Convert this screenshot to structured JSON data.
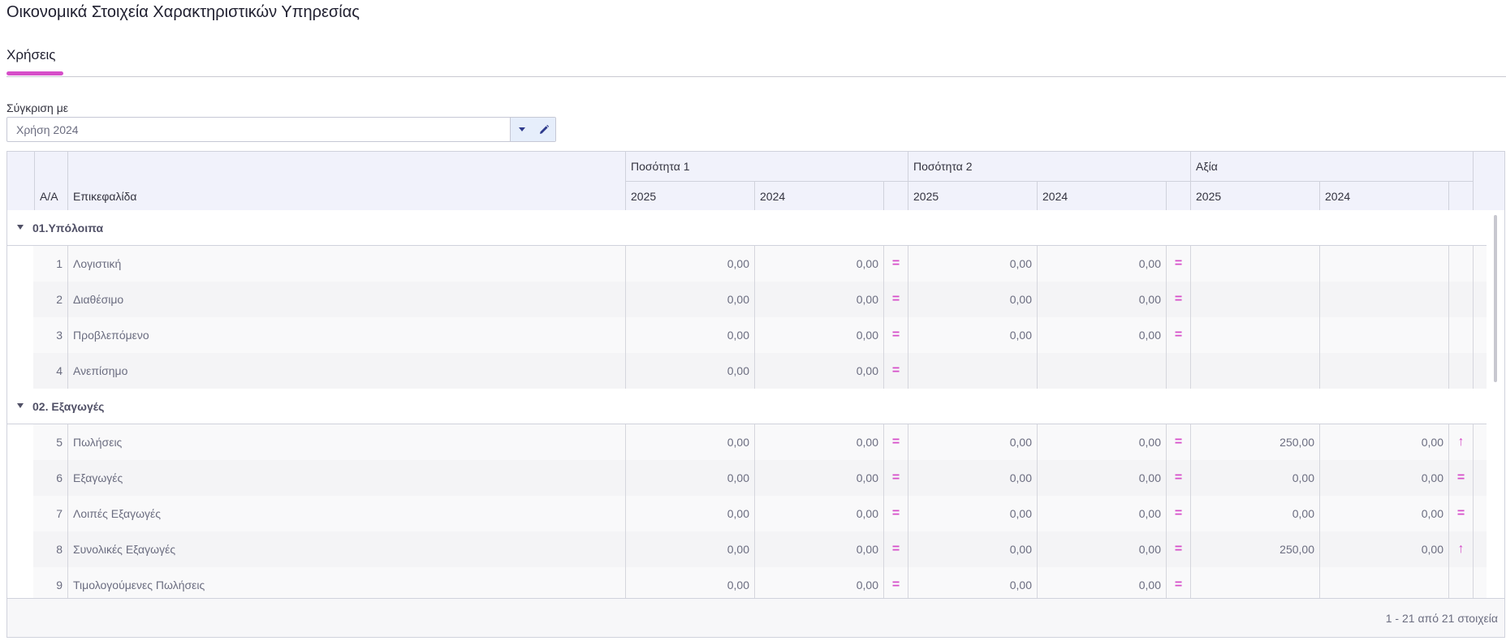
{
  "page": {
    "title": "Οικονομικά Στοιχεία Χαρακτηριστικών Υπηρεσίας"
  },
  "tabs": [
    {
      "label": "Χρήσεις",
      "active": true
    }
  ],
  "compare": {
    "label": "Σύγκριση με",
    "value": "Χρήση 2024"
  },
  "colors": {
    "accent": "#d64ec9",
    "header_bg": "#f1f2fb",
    "button_blue": "#2e3a8c"
  },
  "table": {
    "headers": {
      "index": "Α/Α",
      "title": "Επικεφαλίδα",
      "groups": [
        "Ποσότητα 1",
        "Ποσότητα 2",
        "Αξία"
      ],
      "years": [
        "2025",
        "2024"
      ]
    },
    "groups": [
      {
        "label": "01.Υπόλοιπα",
        "rows": [
          {
            "aa": "1",
            "title": "Λογιστική",
            "q1": [
              "0,00",
              "0,00",
              "="
            ],
            "q2": [
              "0,00",
              "0,00",
              "="
            ],
            "v": [
              "",
              "",
              ""
            ]
          },
          {
            "aa": "2",
            "title": "Διαθέσιμο",
            "q1": [
              "0,00",
              "0,00",
              "="
            ],
            "q2": [
              "0,00",
              "0,00",
              "="
            ],
            "v": [
              "",
              "",
              ""
            ]
          },
          {
            "aa": "3",
            "title": "Προβλεπόμενο",
            "q1": [
              "0,00",
              "0,00",
              "="
            ],
            "q2": [
              "0,00",
              "0,00",
              "="
            ],
            "v": [
              "",
              "",
              ""
            ]
          },
          {
            "aa": "4",
            "title": "Ανεπίσημο",
            "q1": [
              "0,00",
              "0,00",
              "="
            ],
            "q2": [
              "",
              "",
              ""
            ],
            "v": [
              "",
              "",
              ""
            ]
          }
        ]
      },
      {
        "label": "02. Εξαγωγές",
        "rows": [
          {
            "aa": "5",
            "title": "Πωλήσεις",
            "q1": [
              "0,00",
              "0,00",
              "="
            ],
            "q2": [
              "0,00",
              "0,00",
              "="
            ],
            "v": [
              "250,00",
              "0,00",
              "↑"
            ]
          },
          {
            "aa": "6",
            "title": "Εξαγωγές",
            "q1": [
              "0,00",
              "0,00",
              "="
            ],
            "q2": [
              "0,00",
              "0,00",
              "="
            ],
            "v": [
              "0,00",
              "0,00",
              "="
            ]
          },
          {
            "aa": "7",
            "title": "Λοιπές Εξαγωγές",
            "q1": [
              "0,00",
              "0,00",
              "="
            ],
            "q2": [
              "0,00",
              "0,00",
              "="
            ],
            "v": [
              "0,00",
              "0,00",
              "="
            ]
          },
          {
            "aa": "8",
            "title": "Συνολικές Εξαγωγές",
            "q1": [
              "0,00",
              "0,00",
              "="
            ],
            "q2": [
              "0,00",
              "0,00",
              "="
            ],
            "v": [
              "250,00",
              "0,00",
              "↑"
            ]
          },
          {
            "aa": "9",
            "title": "Τιμολογούμενες Πωλήσεις",
            "q1": [
              "0,00",
              "0,00",
              "="
            ],
            "q2": [
              "0,00",
              "0,00",
              "="
            ],
            "v": [
              "",
              "",
              ""
            ]
          }
        ]
      }
    ]
  },
  "pager": {
    "info": "1 - 21 από 21 στοιχεία"
  }
}
